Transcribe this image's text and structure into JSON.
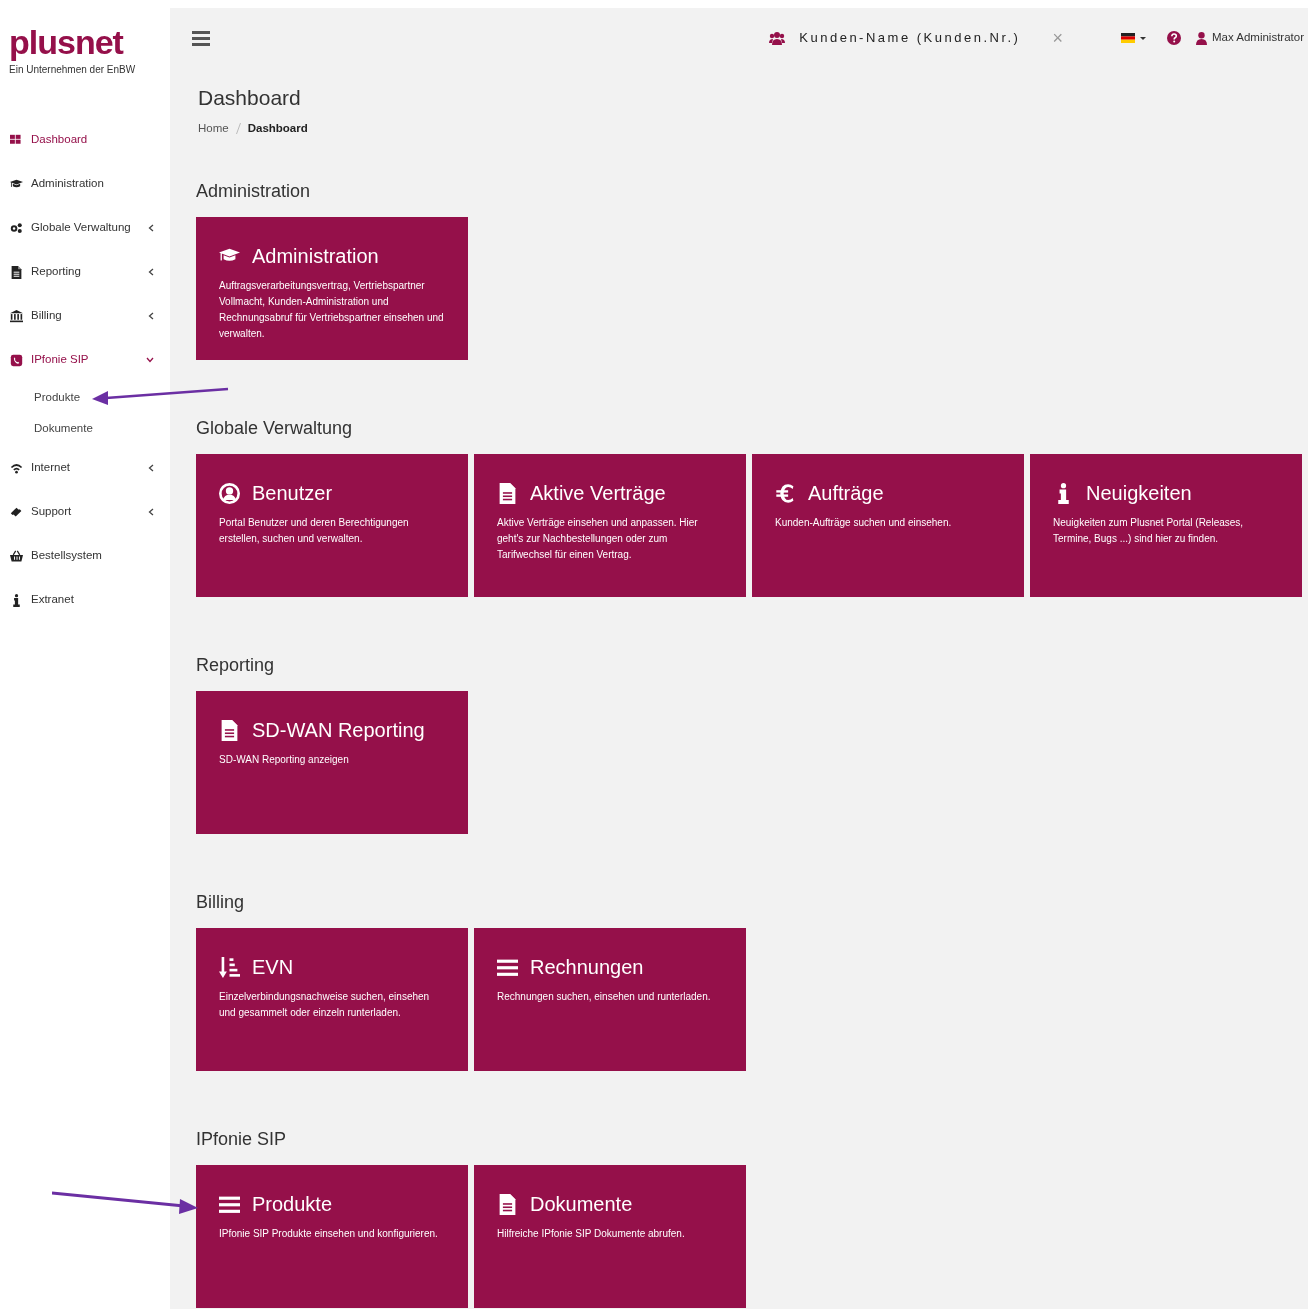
{
  "brand": {
    "logo": "plusnet",
    "tagline": "Ein Unternehmen der EnBW"
  },
  "sidebar": {
    "items": [
      {
        "label": "Dashboard",
        "kind": "link",
        "selected": true
      },
      {
        "label": "Administration",
        "kind": "link",
        "selected": false
      },
      {
        "label": "Globale Verwaltung",
        "kind": "group",
        "selected": false,
        "expanded": false
      },
      {
        "label": "Reporting",
        "kind": "group",
        "selected": false,
        "expanded": false
      },
      {
        "label": "Billing",
        "kind": "group",
        "selected": false,
        "expanded": false
      },
      {
        "label": "IPfonie SIP",
        "kind": "group",
        "selected": true,
        "expanded": true,
        "children": [
          {
            "label": "Produkte"
          },
          {
            "label": "Dokumente"
          }
        ]
      },
      {
        "label": "Internet",
        "kind": "group",
        "selected": false,
        "expanded": false
      },
      {
        "label": "Support",
        "kind": "group",
        "selected": false,
        "expanded": false
      },
      {
        "label": "Bestellsystem",
        "kind": "link",
        "selected": false
      },
      {
        "label": "Extranet",
        "kind": "link",
        "selected": false
      }
    ]
  },
  "topbar": {
    "customer": "Kunden-Name (Kunden.Nr.)",
    "clear": "×",
    "user": "Max Administrator"
  },
  "page": {
    "title": "Dashboard",
    "breadcrumb": [
      "Home",
      "Dashboard"
    ]
  },
  "sections": [
    {
      "title": "Administration",
      "cards": [
        {
          "title": "Administration",
          "text": "Auftragsverarbeitungsvertrag, Vertriebspartner Vollmacht, Kunden-Administration und Rechnungsabruf für Vertriebspartner einsehen und verwalten."
        }
      ]
    },
    {
      "title": "Globale Verwaltung",
      "cards": [
        {
          "title": "Benutzer",
          "text": "Portal Benutzer und deren Berechtigungen erstellen, suchen und verwalten."
        },
        {
          "title": "Aktive Verträge",
          "text": "Aktive Verträge einsehen und anpassen. Hier geht's zur Nachbestellungen oder zum Tarifwechsel für einen Vertrag."
        },
        {
          "title": "Aufträge",
          "text": "Kunden-Aufträge suchen und einsehen."
        },
        {
          "title": "Neuigkeiten",
          "text": "Neuigkeiten zum Plusnet Portal (Releases, Termine, Bugs ...) sind hier zu finden."
        }
      ]
    },
    {
      "title": "Reporting",
      "cards": [
        {
          "title": "SD-WAN Reporting",
          "text": "SD-WAN Reporting anzeigen"
        }
      ]
    },
    {
      "title": "Billing",
      "cards": [
        {
          "title": "EVN",
          "text": "Einzelverbindungsnachweise suchen, einsehen und gesammelt oder einzeln runterladen."
        },
        {
          "title": "Rechnungen",
          "text": "Rechnungen suchen, einsehen und runterladen."
        }
      ]
    },
    {
      "title": "IPfonie SIP",
      "cards": [
        {
          "title": "Produkte",
          "text": "IPfonie SIP Produkte einsehen und konfigurieren."
        },
        {
          "title": "Dokumente",
          "text": "Hilfreiche IPfonie SIP Dokumente abrufen."
        }
      ]
    }
  ]
}
